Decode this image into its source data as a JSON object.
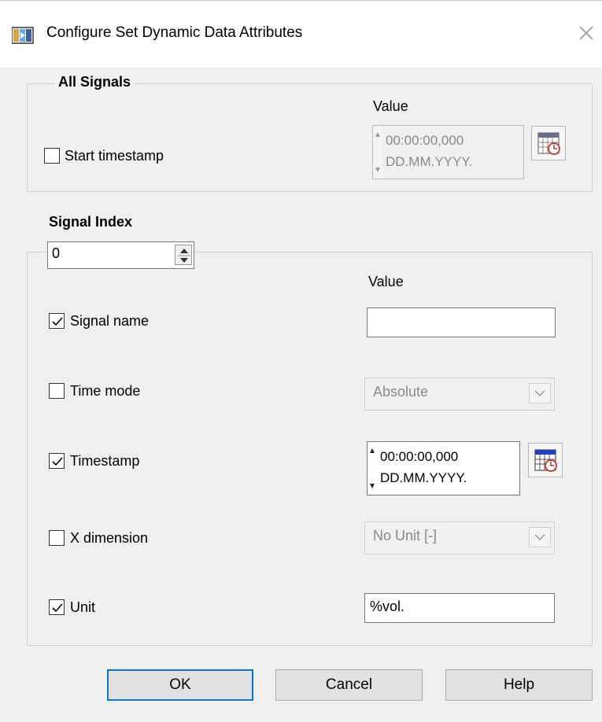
{
  "window": {
    "title": "Configure Set Dynamic Data Attributes"
  },
  "all_signals": {
    "legend": "All Signals",
    "value_header": "Value",
    "start_timestamp": {
      "label": "Start timestamp",
      "checked": false,
      "time": "00:00:00,000",
      "date": "DD.MM.YYYY."
    }
  },
  "signal_index": {
    "label": "Signal Index",
    "value": "0"
  },
  "signal_group": {
    "value_header": "Value",
    "signal_name": {
      "label": "Signal name",
      "checked": true,
      "value": ""
    },
    "time_mode": {
      "label": "Time mode",
      "checked": false,
      "selected": "Absolute"
    },
    "timestamp": {
      "label": "Timestamp",
      "checked": true,
      "time": "00:00:00,000",
      "date": "DD.MM.YYYY."
    },
    "x_dimension": {
      "label": "X dimension",
      "checked": false,
      "selected": "No Unit [-]"
    },
    "unit": {
      "label": "Unit",
      "checked": true,
      "value": "%vol."
    }
  },
  "buttons": {
    "ok": "OK",
    "cancel": "Cancel",
    "help": "Help"
  },
  "colors": {
    "default_button_border": "#0078d7",
    "window_bg": "#f0f0f0",
    "calendar_header": "#1f3fbf",
    "clock_red": "#c0392b"
  }
}
